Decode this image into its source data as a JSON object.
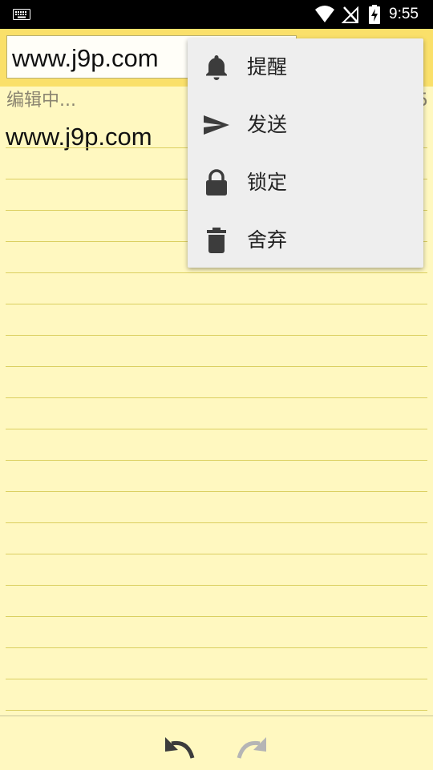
{
  "status_bar": {
    "time": "9:55",
    "icons": [
      "keyboard-icon",
      "wifi-icon",
      "no-signal-icon",
      "battery-charging-icon"
    ]
  },
  "editor": {
    "title_value": "www.j9p.com",
    "status_text": "编辑中...",
    "count_text": "5",
    "body_text": "www.j9p.com"
  },
  "menu": {
    "items": [
      {
        "label": "提醒",
        "icon": "bell-icon"
      },
      {
        "label": "发送",
        "icon": "send-icon"
      },
      {
        "label": "锁定",
        "icon": "lock-icon"
      },
      {
        "label": "舍弃",
        "icon": "trash-icon"
      }
    ]
  },
  "bottom_bar": {
    "icons": [
      "undo-icon",
      "redo-icon"
    ]
  },
  "colors": {
    "paper": "#fff8c0",
    "toolbar": "#fae06a",
    "rule_line": "#dbcf60",
    "menu_bg": "#eeeeee",
    "icon_dark": "#3c3c3c",
    "icon_disabled": "#b5b5b5"
  }
}
